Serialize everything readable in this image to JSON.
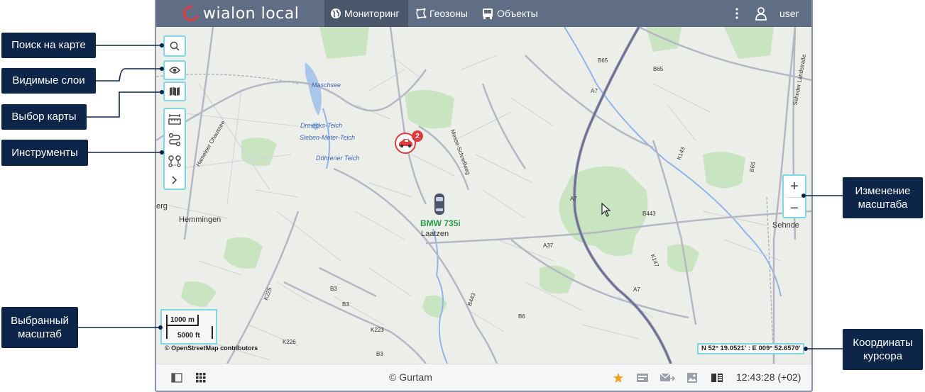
{
  "app": {
    "logo_text": "wialon local",
    "nav": [
      {
        "label": "Мониторинг",
        "icon": "globe-icon",
        "active": true
      },
      {
        "label": "Геозоны",
        "icon": "geofence-icon",
        "active": false
      },
      {
        "label": "Объекты",
        "icon": "bus-icon",
        "active": false
      }
    ],
    "user": "user"
  },
  "map": {
    "labels": {
      "lake1": "Maschsee",
      "lake2": "Dreiecks-Teich",
      "lake3": "Sieben-Meter-Teich",
      "lake4": "Döhrener Teich",
      "town1": "Hemmingen",
      "town2": "Laatzen",
      "town3": "Sehnde",
      "town4": "erg",
      "road_b65a": "B65",
      "road_b65b": "B65",
      "road_a7a": "A7",
      "road_a7b": "A7",
      "road_a7c": "A7",
      "road_b443": "B443",
      "road_a37": "A37",
      "road_k147": "K147",
      "road_b3a": "B3",
      "road_b3b": "B3",
      "road_b3c": "B3",
      "road_b6": "B6",
      "road_k223": "K223",
      "road_k226": "K226",
      "road_k225": "K225",
      "road_b443b": "B443",
      "road_b65c": "B65",
      "road_k143": "K143",
      "street1": "Hamelner Chaussee",
      "street2": "Messe-Schnellweg",
      "street3": "Sehnder Landstraße"
    },
    "unit_group_count": "2",
    "unit_name": "BMW 735i",
    "scale_metric": "1000 m",
    "scale_imperial": "5000 ft",
    "attribution": "© OpenStreetMap contributors",
    "coords": "N 52° 19.0521' : E 009° 52.6570'"
  },
  "zoom": {
    "plus": "+",
    "minus": "−"
  },
  "bottom": {
    "copyright": "© Gurtam",
    "time": "12:43:28 (+02)"
  },
  "callouts": {
    "search": "Поиск на карте",
    "layers": "Видимые слои",
    "mapsel": "Выбор карты",
    "tools": "Инструменты",
    "scale": "Выбранный масштаб",
    "zoom": "Изменение масштаба",
    "coords": "Координаты курсора"
  },
  "colors": {
    "topbar": "#5f6e85",
    "accent_highlight": "#7fd6e6",
    "callout_bg": "#0d2548",
    "alert_red": "#e0393e",
    "unit_label_green": "#2a9a4a"
  }
}
